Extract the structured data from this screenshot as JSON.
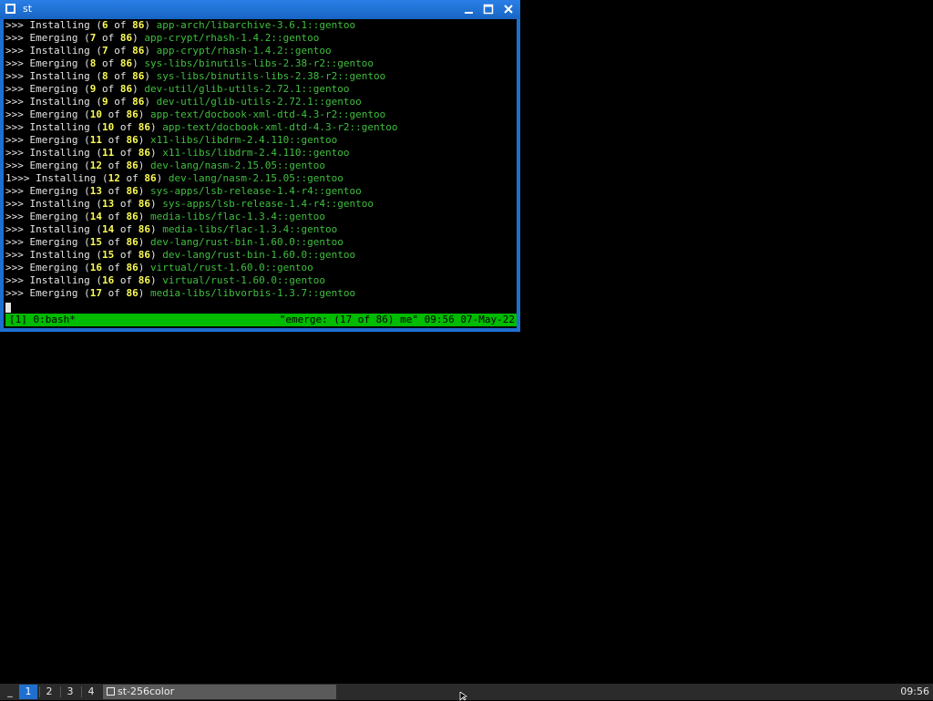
{
  "window": {
    "title": "st",
    "minimize_label": "minimize",
    "maximize_label": "maximize",
    "close_label": "close"
  },
  "terminal": {
    "lines": [
      {
        "pre": ">>> Installing (",
        "n": "6",
        "mid": " of ",
        "t": "86",
        "post": ") ",
        "pkg": "app-arch/libarchive-3.6.1::gentoo"
      },
      {
        "pre": ">>> Emerging (",
        "n": "7",
        "mid": " of ",
        "t": "86",
        "post": ") ",
        "pkg": "app-crypt/rhash-1.4.2::gentoo"
      },
      {
        "pre": ">>> Installing (",
        "n": "7",
        "mid": " of ",
        "t": "86",
        "post": ") ",
        "pkg": "app-crypt/rhash-1.4.2::gentoo"
      },
      {
        "pre": ">>> Emerging (",
        "n": "8",
        "mid": " of ",
        "t": "86",
        "post": ") ",
        "pkg": "sys-libs/binutils-libs-2.38-r2::gentoo"
      },
      {
        "pre": ">>> Installing (",
        "n": "8",
        "mid": " of ",
        "t": "86",
        "post": ") ",
        "pkg": "sys-libs/binutils-libs-2.38-r2::gentoo"
      },
      {
        "pre": ">>> Emerging (",
        "n": "9",
        "mid": " of ",
        "t": "86",
        "post": ") ",
        "pkg": "dev-util/glib-utils-2.72.1::gentoo"
      },
      {
        "pre": ">>> Installing (",
        "n": "9",
        "mid": " of ",
        "t": "86",
        "post": ") ",
        "pkg": "dev-util/glib-utils-2.72.1::gentoo"
      },
      {
        "pre": ">>> Emerging (",
        "n": "10",
        "mid": " of ",
        "t": "86",
        "post": ") ",
        "pkg": "app-text/docbook-xml-dtd-4.3-r2::gentoo"
      },
      {
        "pre": ">>> Installing (",
        "n": "10",
        "mid": " of ",
        "t": "86",
        "post": ") ",
        "pkg": "app-text/docbook-xml-dtd-4.3-r2::gentoo"
      },
      {
        "pre": ">>> Emerging (",
        "n": "11",
        "mid": " of ",
        "t": "86",
        "post": ") ",
        "pkg": "x11-libs/libdrm-2.4.110::gentoo"
      },
      {
        "pre": ">>> Installing (",
        "n": "11",
        "mid": " of ",
        "t": "86",
        "post": ") ",
        "pkg": "x11-libs/libdrm-2.4.110::gentoo"
      },
      {
        "pre": ">>> Emerging (",
        "n": "12",
        "mid": " of ",
        "t": "86",
        "post": ") ",
        "pkg": "dev-lang/nasm-2.15.05::gentoo"
      },
      {
        "pre": "1>>> Installing (",
        "n": "12",
        "mid": " of ",
        "t": "86",
        "post": ") ",
        "pkg": "dev-lang/nasm-2.15.05::gentoo"
      },
      {
        "pre": ">>> Emerging (",
        "n": "13",
        "mid": " of ",
        "t": "86",
        "post": ") ",
        "pkg": "sys-apps/lsb-release-1.4-r4::gentoo"
      },
      {
        "pre": ">>> Installing (",
        "n": "13",
        "mid": " of ",
        "t": "86",
        "post": ") ",
        "pkg": "sys-apps/lsb-release-1.4-r4::gentoo"
      },
      {
        "pre": ">>> Emerging (",
        "n": "14",
        "mid": " of ",
        "t": "86",
        "post": ") ",
        "pkg": "media-libs/flac-1.3.4::gentoo"
      },
      {
        "pre": ">>> Installing (",
        "n": "14",
        "mid": " of ",
        "t": "86",
        "post": ") ",
        "pkg": "media-libs/flac-1.3.4::gentoo"
      },
      {
        "pre": ">>> Emerging (",
        "n": "15",
        "mid": " of ",
        "t": "86",
        "post": ") ",
        "pkg": "dev-lang/rust-bin-1.60.0::gentoo"
      },
      {
        "pre": ">>> Installing (",
        "n": "15",
        "mid": " of ",
        "t": "86",
        "post": ") ",
        "pkg": "dev-lang/rust-bin-1.60.0::gentoo"
      },
      {
        "pre": ">>> Emerging (",
        "n": "16",
        "mid": " of ",
        "t": "86",
        "post": ") ",
        "pkg": "virtual/rust-1.60.0::gentoo"
      },
      {
        "pre": ">>> Installing (",
        "n": "16",
        "mid": " of ",
        "t": "86",
        "post": ") ",
        "pkg": "virtual/rust-1.60.0::gentoo"
      },
      {
        "pre": ">>> Emerging (",
        "n": "17",
        "mid": " of ",
        "t": "86",
        "post": ") ",
        "pkg": "media-libs/libvorbis-1.3.7::gentoo"
      }
    ],
    "status_left": "[1] 0:bash*",
    "status_right": "\"emerge: (17 of 86) me\" 09:56 07-May-22"
  },
  "taskbar": {
    "menu_label": "_",
    "workspaces": [
      "1",
      "2",
      "3",
      "4"
    ],
    "active_workspace": "1",
    "task_label": "st-256color",
    "clock": "09:56"
  },
  "colors": {
    "titlebar": "#1e6fd0",
    "status_green": "#00bb00",
    "package_green": "#3fbf3f",
    "number_yellow": "#fcfc54"
  }
}
